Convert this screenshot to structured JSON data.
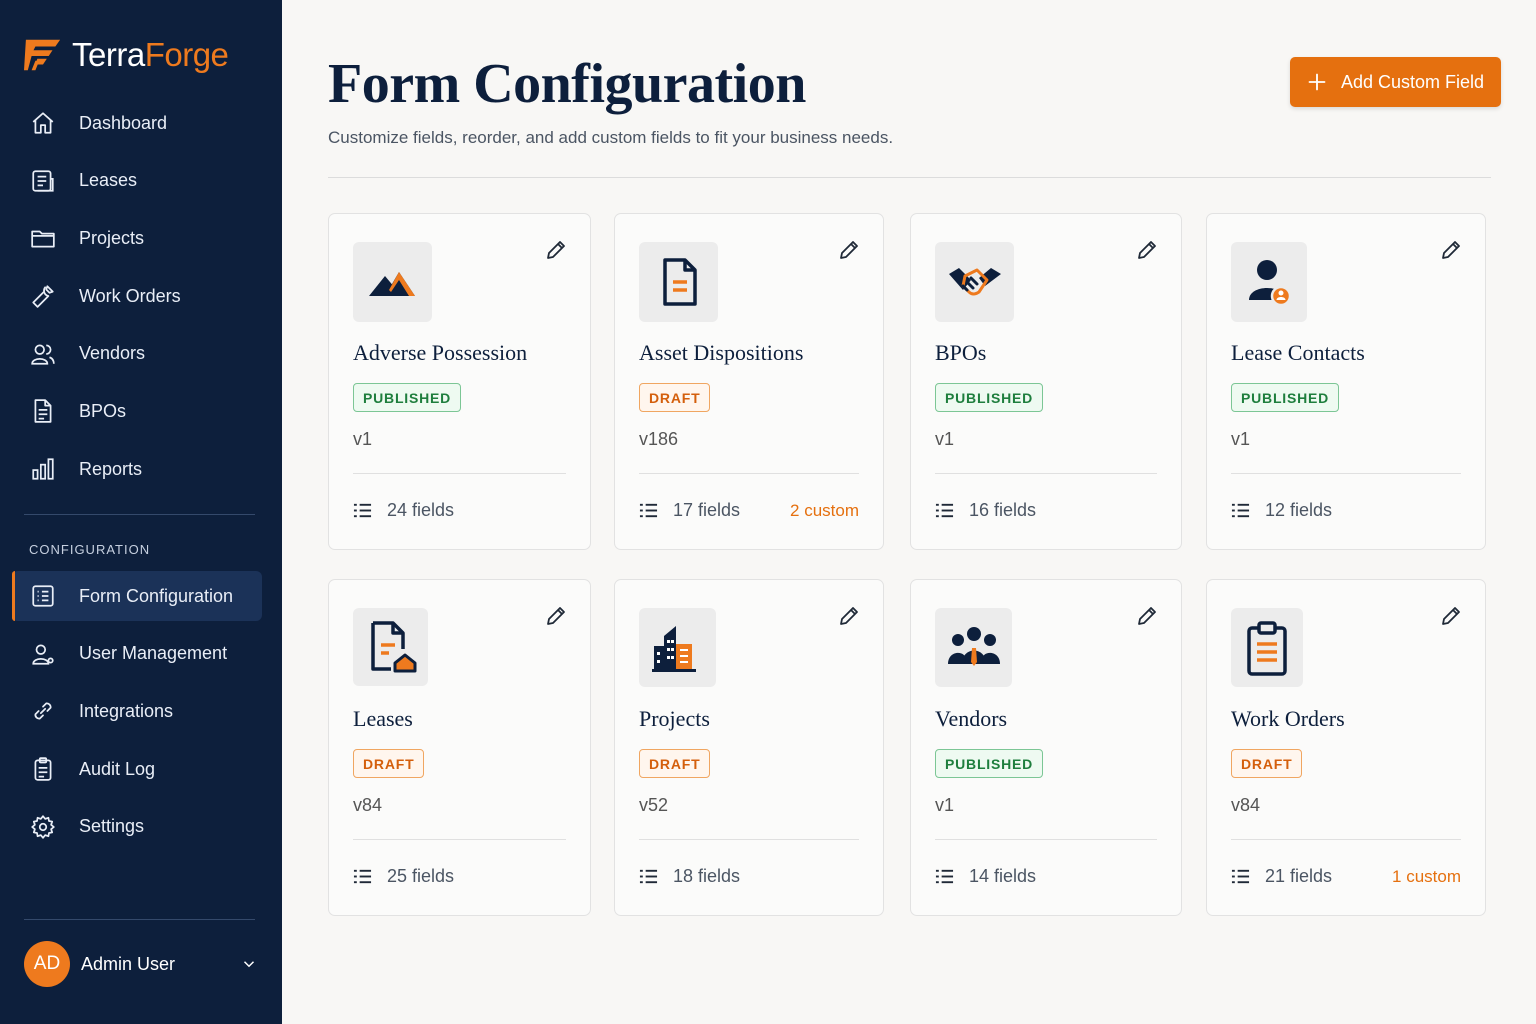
{
  "brand": {
    "part1": "Terra",
    "part2": "Forge"
  },
  "nav": [
    {
      "label": "Dashboard",
      "icon": "home-icon"
    },
    {
      "label": "Leases",
      "icon": "leases-icon"
    },
    {
      "label": "Projects",
      "icon": "folder-icon"
    },
    {
      "label": "Work Orders",
      "icon": "wrench-icon"
    },
    {
      "label": "Vendors",
      "icon": "users-icon"
    },
    {
      "label": "BPOs",
      "icon": "document-icon"
    },
    {
      "label": "Reports",
      "icon": "bar-chart-icon"
    }
  ],
  "config_section": "CONFIGURATION",
  "config_nav": [
    {
      "label": "Form Configuration",
      "icon": "form-list-icon",
      "active": true
    },
    {
      "label": "User Management",
      "icon": "user-management-icon"
    },
    {
      "label": "Integrations",
      "icon": "link-icon"
    },
    {
      "label": "Audit Log",
      "icon": "clipboard-icon"
    },
    {
      "label": "Settings",
      "icon": "gear-icon"
    }
  ],
  "user": {
    "initials": "AD",
    "name": "Admin User"
  },
  "header": {
    "title": "Form Configuration",
    "subtitle": "Customize fields, reorder, and add custom fields to fit your business needs.",
    "add_button": "Add Custom Field"
  },
  "forms": [
    {
      "name": "Adverse Possession",
      "status": "PUBLISHED",
      "version": "v1",
      "fields": "24 fields",
      "custom": "",
      "icon": "mountain-icon"
    },
    {
      "name": "Asset Dispositions",
      "status": "DRAFT",
      "version": "v186",
      "fields": "17 fields",
      "custom": "2 custom",
      "icon": "document-icon"
    },
    {
      "name": "BPOs",
      "status": "PUBLISHED",
      "version": "v1",
      "fields": "16 fields",
      "custom": "",
      "icon": "handshake-icon"
    },
    {
      "name": "Lease Contacts",
      "status": "PUBLISHED",
      "version": "v1",
      "fields": "12 fields",
      "custom": "",
      "icon": "contact-icon"
    },
    {
      "name": "Leases",
      "status": "DRAFT",
      "version": "v84",
      "fields": "25 fields",
      "custom": "",
      "icon": "lease-house-icon"
    },
    {
      "name": "Projects",
      "status": "DRAFT",
      "version": "v52",
      "fields": "18 fields",
      "custom": "",
      "icon": "buildings-icon"
    },
    {
      "name": "Vendors",
      "status": "PUBLISHED",
      "version": "v1",
      "fields": "14 fields",
      "custom": "",
      "icon": "team-icon"
    },
    {
      "name": "Work Orders",
      "status": "DRAFT",
      "version": "v84",
      "fields": "21 fields",
      "custom": "1 custom",
      "icon": "clipboard-list-icon"
    }
  ],
  "colors": {
    "sidebar": "#0d1f3c",
    "accent": "#e5700f",
    "published": "#1e7e3d",
    "draft": "#d45f0c"
  }
}
